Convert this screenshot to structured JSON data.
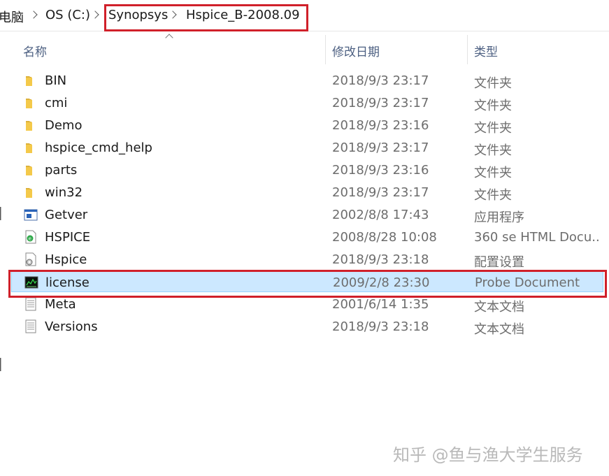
{
  "breadcrumb": {
    "items": [
      "电脑",
      "OS (C:)",
      "Synopsys",
      "Hspice_B-2008.09"
    ]
  },
  "columns": {
    "name": "名称",
    "date": "修改日期",
    "type": "类型"
  },
  "files": [
    {
      "name": "BIN",
      "date": "2018/9/3 23:17",
      "type": "文件夹",
      "icon": "folder-icon"
    },
    {
      "name": "cmi",
      "date": "2018/9/3 23:17",
      "type": "文件夹",
      "icon": "folder-icon"
    },
    {
      "name": "Demo",
      "date": "2018/9/3 23:16",
      "type": "文件夹",
      "icon": "folder-icon"
    },
    {
      "name": "hspice_cmd_help",
      "date": "2018/9/3 23:17",
      "type": "文件夹",
      "icon": "folder-icon"
    },
    {
      "name": "parts",
      "date": "2018/9/3 23:16",
      "type": "文件夹",
      "icon": "folder-icon"
    },
    {
      "name": "win32",
      "date": "2018/9/3 23:17",
      "type": "文件夹",
      "icon": "folder-icon"
    },
    {
      "name": "Getver",
      "date": "2002/8/8 17:43",
      "type": "应用程序",
      "icon": "application-icon"
    },
    {
      "name": "HSPICE",
      "date": "2008/8/28 10:08",
      "type": "360 se HTML Docu...",
      "icon": "html-document-icon"
    },
    {
      "name": "Hspice",
      "date": "2018/9/3 23:18",
      "type": "配置设置",
      "icon": "config-settings-icon"
    },
    {
      "name": "license",
      "date": "2009/2/8 23:30",
      "type": "Probe Document",
      "icon": "probe-document-icon",
      "selected": true
    },
    {
      "name": "Meta",
      "date": "2001/6/14 1:35",
      "type": "文本文档",
      "icon": "text-document-icon"
    },
    {
      "name": "Versions",
      "date": "2018/9/3 23:18",
      "type": "文本文档",
      "icon": "text-document-icon"
    }
  ],
  "watermark": "知乎 @鱼与渔大学生服务",
  "colors": {
    "highlight": "#d0202a",
    "selection": "#cce8ff",
    "header_text": "#4d6082"
  }
}
